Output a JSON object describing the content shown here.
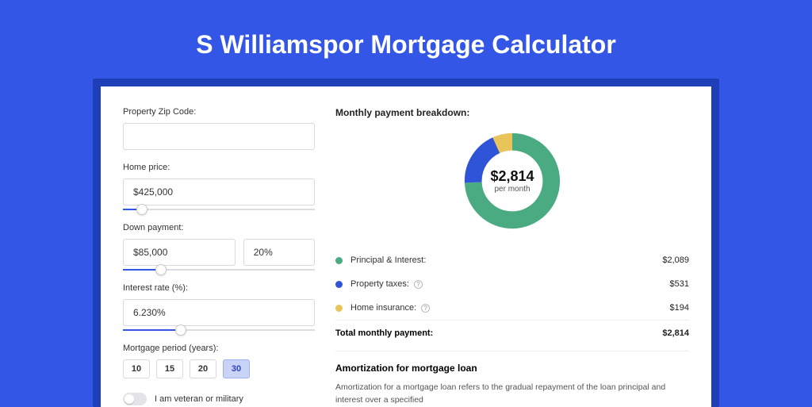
{
  "title": "S Williamspor Mortgage Calculator",
  "form": {
    "zip_label": "Property Zip Code:",
    "zip_value": "",
    "home_price_label": "Home price:",
    "home_price_value": "$425,000",
    "home_price_slider_pct": 10,
    "down_payment_label": "Down payment:",
    "down_payment_value": "$85,000",
    "down_payment_pct_value": "20%",
    "down_payment_slider_pct": 20,
    "interest_label": "Interest rate (%):",
    "interest_value": "6.230%",
    "interest_slider_pct": 30,
    "period_label": "Mortgage period (years):",
    "periods": [
      "10",
      "15",
      "20",
      "30"
    ],
    "period_selected": "30",
    "veteran_label": "I am veteran or military"
  },
  "breakdown": {
    "title": "Monthly payment breakdown:",
    "donut_amount": "$2,814",
    "donut_sub": "per month",
    "items": [
      {
        "label": "Principal & Interest:",
        "amount": "$2,089",
        "color": "#4aab82",
        "help": false
      },
      {
        "label": "Property taxes:",
        "amount": "$531",
        "color": "#2f54d8",
        "help": true
      },
      {
        "label": "Home insurance:",
        "amount": "$194",
        "color": "#e8c45a",
        "help": true
      }
    ],
    "total_label": "Total monthly payment:",
    "total_amount": "$2,814"
  },
  "chart_data": {
    "type": "pie",
    "title": "Monthly payment breakdown",
    "series": [
      {
        "name": "Principal & Interest",
        "value": 2089,
        "color": "#4aab82"
      },
      {
        "name": "Property taxes",
        "value": 531,
        "color": "#2f54d8"
      },
      {
        "name": "Home insurance",
        "value": 194,
        "color": "#e8c45a"
      }
    ],
    "total": 2814
  },
  "amortization": {
    "title": "Amortization for mortgage loan",
    "text": "Amortization for a mortgage loan refers to the gradual repayment of the loan principal and interest over a specified"
  }
}
